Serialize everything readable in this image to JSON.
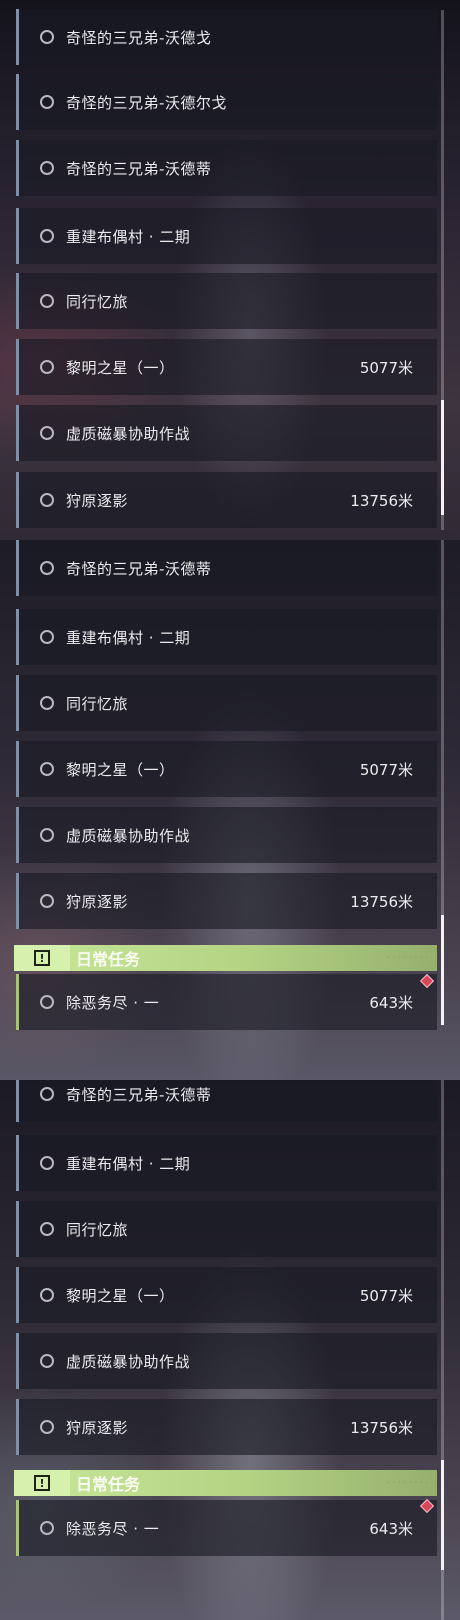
{
  "panel1": {
    "tasks": [
      {
        "name": "奇怪的三兄弟-沃德戈",
        "distance": ""
      },
      {
        "name": "奇怪的三兄弟-沃德尔戈",
        "distance": ""
      },
      {
        "name": "奇怪的三兄弟-沃德蒂",
        "distance": ""
      },
      {
        "name": "重建布偶村 · 二期",
        "distance": ""
      },
      {
        "name": "同行忆旅",
        "distance": ""
      },
      {
        "name": "黎明之星（一）",
        "distance": "5077米"
      },
      {
        "name": "虚质磁暴协助作战",
        "distance": ""
      },
      {
        "name": "狩原逐影",
        "distance": "13756米"
      }
    ]
  },
  "panel2": {
    "tasks": [
      {
        "name": "奇怪的三兄弟-沃德蒂",
        "distance": ""
      },
      {
        "name": "重建布偶村 · 二期",
        "distance": ""
      },
      {
        "name": "同行忆旅",
        "distance": ""
      },
      {
        "name": "黎明之星（一）",
        "distance": "5077米"
      },
      {
        "name": "虚质磁暴协助作战",
        "distance": ""
      },
      {
        "name": "狩原逐影",
        "distance": "13756米"
      }
    ],
    "daily_header": {
      "icon": "!",
      "title": "日常任务"
    },
    "daily_tasks": [
      {
        "name": "除恶务尽 · 一",
        "distance": "643米"
      }
    ]
  },
  "panel3": {
    "tasks": [
      {
        "name": "奇怪的三兄弟-沃德蒂",
        "distance": ""
      },
      {
        "name": "重建布偶村 · 二期",
        "distance": ""
      },
      {
        "name": "同行忆旅",
        "distance": ""
      },
      {
        "name": "黎明之星（一）",
        "distance": "5077米"
      },
      {
        "name": "虚质磁暴协助作战",
        "distance": ""
      },
      {
        "name": "狩原逐影",
        "distance": "13756米"
      }
    ],
    "daily_header": {
      "icon": "!",
      "title": "日常任务"
    },
    "daily_tasks": [
      {
        "name": "除恶务尽 · 一",
        "distance": "643米"
      }
    ]
  },
  "colors": {
    "quest_bar": "#7f8fa6",
    "daily_accent": "#b4d383",
    "track_marker": "#d9455a"
  },
  "icons": {
    "quest_status": "radio-circle-icon",
    "daily_header": "exclamation-box-icon",
    "tracked_marker": "diamond-marker-icon"
  }
}
